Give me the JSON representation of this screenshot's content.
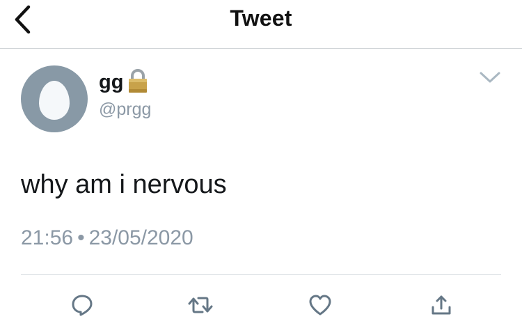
{
  "nav": {
    "title": "Tweet",
    "back_icon": "chevron-left-icon"
  },
  "tweet": {
    "display_name": "gg",
    "protected_icon": "lock-icon",
    "handle": "@prgg",
    "text": "why am i nervous",
    "time": "21:56",
    "separator": "•",
    "date": "23/05/2020"
  },
  "actions": [
    "reply-icon",
    "retweet-icon",
    "like-icon",
    "share-icon"
  ],
  "colors": {
    "avatar_bg": "#8899a6",
    "secondary_text": "#8b98a5",
    "icon_gray": "#657786",
    "divider": "#d8dde1"
  }
}
